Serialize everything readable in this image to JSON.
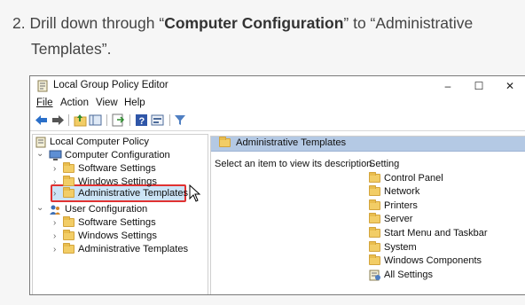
{
  "instruction": {
    "prefix": "2. Drill down through “",
    "bold": "Computer Configuration",
    "mid": "” to “Administrative",
    "line2": "Templates”."
  },
  "window": {
    "title": "Local Group Policy Editor",
    "controls": {
      "minimize": "–",
      "maximize": "☐",
      "close": "✕"
    }
  },
  "menu": [
    "File",
    "Action",
    "View",
    "Help"
  ],
  "toolbar_icons": [
    "back-arrow-icon",
    "forward-arrow-icon",
    "up-folder-icon",
    "show-hide-tree-icon",
    "export-list-icon",
    "help-icon",
    "properties-icon",
    "filter-icon"
  ],
  "tree": [
    {
      "label": "Local Computer Policy",
      "level": 0,
      "expander": ""
    },
    {
      "label": "Computer Configuration",
      "level": 1,
      "expander": "⌄"
    },
    {
      "label": "Software Settings",
      "level": 2,
      "expander": "›"
    },
    {
      "label": "Windows Settings",
      "level": 2,
      "expander": "›"
    },
    {
      "label": "Administrative Templates",
      "level": 2,
      "expander": "›",
      "selected": true
    },
    {
      "label": "User Configuration",
      "level": 1,
      "expander": "⌄"
    },
    {
      "label": "Software Settings",
      "level": 2,
      "expander": "›"
    },
    {
      "label": "Windows Settings",
      "level": 2,
      "expander": "›"
    },
    {
      "label": "Administrative Templates",
      "level": 2,
      "expander": "›"
    }
  ],
  "right": {
    "header": "Administrative Templates",
    "description": "Select an item to view its description.",
    "column": "Setting",
    "items": [
      "Control Panel",
      "Network",
      "Printers",
      "Server",
      "Start Menu and Taskbar",
      "System",
      "Windows Components",
      "All Settings"
    ]
  },
  "colors": {
    "highlight_border": "#e03232",
    "selection": "#cce4f7",
    "header": "#b4c9e4"
  }
}
